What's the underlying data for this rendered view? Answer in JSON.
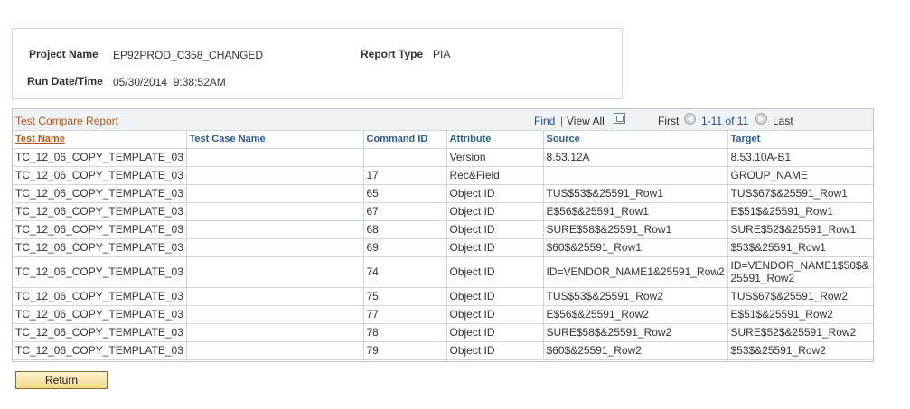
{
  "info": {
    "project_name_label": "Project Name",
    "project_name_value": "EP92PROD_C358_CHANGED",
    "report_type_label": "Report Type",
    "report_type_value": "PIA",
    "run_datetime_label": "Run Date/Time",
    "run_datetime_value": "05/30/2014  9:38:52AM"
  },
  "grid": {
    "title": "Test Compare Report",
    "find": "Find",
    "separator": "|",
    "view_all": "View All",
    "first": "First",
    "range": "1-11 of 11",
    "last": "Last",
    "columns": [
      "Test Name",
      "Test Case Name",
      "Command ID",
      "Attribute",
      "Source",
      "Target"
    ],
    "rows": [
      {
        "test_name": "TC_12_06_COPY_TEMPLATE_03",
        "test_case_name": "",
        "command_id": "",
        "attribute": "Version",
        "source": "8.53.12A",
        "target": "8.53.10A-B1"
      },
      {
        "test_name": "TC_12_06_COPY_TEMPLATE_03",
        "test_case_name": "",
        "command_id": "17",
        "attribute": "Rec&Field",
        "source": "",
        "target": "GROUP_NAME"
      },
      {
        "test_name": "TC_12_06_COPY_TEMPLATE_03",
        "test_case_name": "",
        "command_id": "65",
        "attribute": "Object ID",
        "source": "TUS$53$&25591_Row1",
        "target": "TUS$67$&25591_Row1"
      },
      {
        "test_name": "TC_12_06_COPY_TEMPLATE_03",
        "test_case_name": "",
        "command_id": "67",
        "attribute": "Object ID",
        "source": "E$56$&25591_Row1",
        "target": "E$51$&25591_Row1"
      },
      {
        "test_name": "TC_12_06_COPY_TEMPLATE_03",
        "test_case_name": "",
        "command_id": "68",
        "attribute": "Object ID",
        "source": "SURE$58$&25591_Row1",
        "target": "SURE$52$&25591_Row1"
      },
      {
        "test_name": "TC_12_06_COPY_TEMPLATE_03",
        "test_case_name": "",
        "command_id": "69",
        "attribute": "Object ID",
        "source": "$60$&25591_Row1",
        "target": "$53$&25591_Row1"
      },
      {
        "test_name": "TC_12_06_COPY_TEMPLATE_03",
        "test_case_name": "",
        "command_id": "74",
        "attribute": "Object ID",
        "source": "ID=VENDOR_NAME1&25591_Row2",
        "target": "ID=VENDOR_NAME1$50$&25591_Row2"
      },
      {
        "test_name": "TC_12_06_COPY_TEMPLATE_03",
        "test_case_name": "",
        "command_id": "75",
        "attribute": "Object ID",
        "source": "TUS$53$&25591_Row2",
        "target": "TUS$67$&25591_Row2"
      },
      {
        "test_name": "TC_12_06_COPY_TEMPLATE_03",
        "test_case_name": "",
        "command_id": "77",
        "attribute": "Object ID",
        "source": "E$56$&25591_Row2",
        "target": "E$51$&25591_Row2"
      },
      {
        "test_name": "TC_12_06_COPY_TEMPLATE_03",
        "test_case_name": "",
        "command_id": "78",
        "attribute": "Object ID",
        "source": "SURE$58$&25591_Row2",
        "target": "SURE$52$&25591_Row2"
      },
      {
        "test_name": "TC_12_06_COPY_TEMPLATE_03",
        "test_case_name": "",
        "command_id": "79",
        "attribute": "Object ID",
        "source": "$60$&25591_Row2",
        "target": "$53$&25591_Row2"
      }
    ]
  },
  "icons": {
    "zoom": "view-grid-zoom-icon",
    "prev": "previous-arrow-icon",
    "next": "next-arrow-icon"
  },
  "colors": {
    "title": "#b35a1a",
    "link": "#1f4e96",
    "header_text": "#2a5d8f"
  },
  "return_label": "Return"
}
